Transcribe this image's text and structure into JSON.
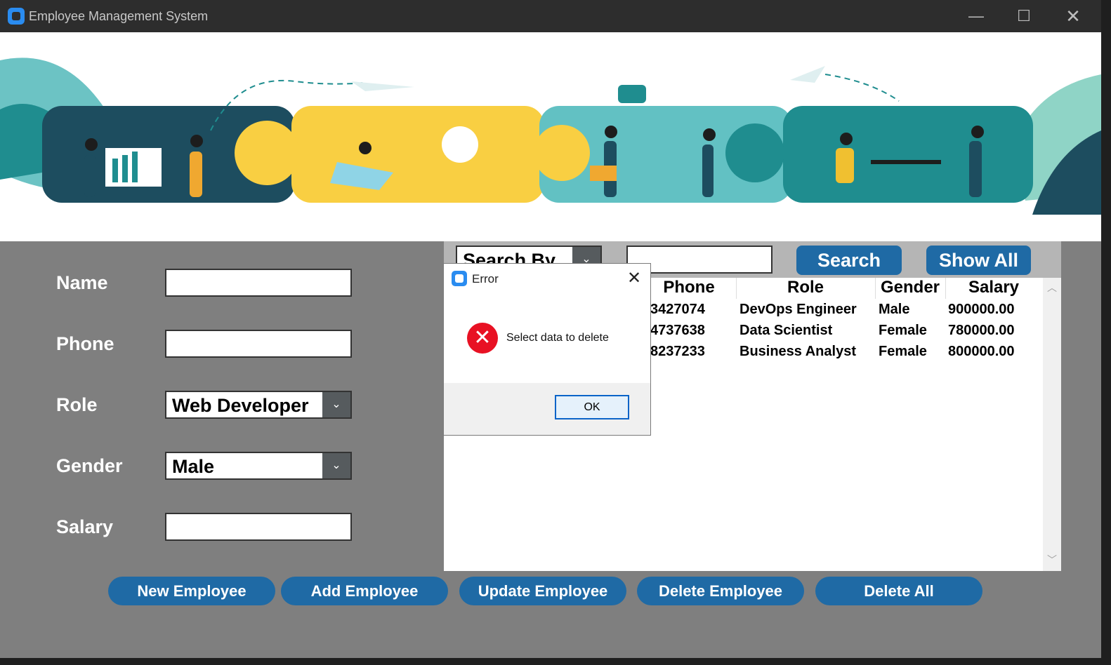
{
  "window": {
    "title": "Employee Management System",
    "minimize": "—",
    "maximize": "☐",
    "close": "✕"
  },
  "form": {
    "name_label": "Name",
    "phone_label": "Phone",
    "role_label": "Role",
    "gender_label": "Gender",
    "salary_label": "Salary",
    "name_value": "",
    "phone_value": "",
    "role_value": "Web Developer",
    "gender_value": "Male",
    "salary_value": ""
  },
  "search": {
    "search_by_label": "Search By",
    "query_value": "",
    "search_button": "Search",
    "show_all_button": "Show All"
  },
  "table": {
    "columns": [
      "Phone",
      "Role",
      "Gender",
      "Salary"
    ],
    "rows": [
      [
        "3427074",
        "DevOps Engineer",
        "Male",
        "900000.00"
      ],
      [
        "4737638",
        "Data Scientist",
        "Female",
        "780000.00"
      ],
      [
        "8237233",
        "Business Analyst",
        "Female",
        "800000.00"
      ]
    ]
  },
  "actions": {
    "new": "New Employee",
    "add": "Add Employee",
    "update": "Update Employee",
    "delete": "Delete Employee",
    "delete_all": "Delete All"
  },
  "dialog": {
    "title": "Error",
    "message": "Select data to delete",
    "ok": "OK",
    "close": "✕"
  },
  "colors": {
    "accent": "#1f6aa5",
    "panel": "#7f7f7f",
    "error": "#e81123"
  }
}
